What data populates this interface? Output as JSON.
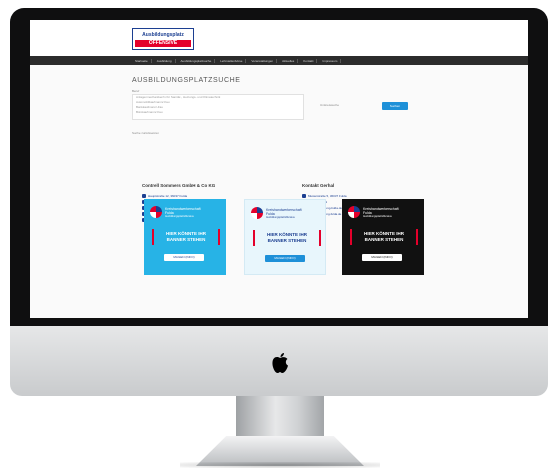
{
  "header": {
    "logo_line1": "Ausbildungsplatz",
    "logo_line2": "OFFENSIVE",
    "nav": [
      "Startseite",
      "Ausbildung",
      "Ausbildungsplatzsuche",
      "Lehrstellenbörse",
      "Veranstaltungen",
      "Aktuelles",
      "Kontakt",
      "Impressum"
    ]
  },
  "search": {
    "title": "AUSBILDUNGSPLATZSUCHE",
    "filter_label": "Beruf",
    "options": [
      "Anlagenmechaniker/in für Sanitär-, Heizungs- und Klimatechnik",
      "Automobilkaufmann/-frau",
      "Bankkaufmann/-frau",
      "Bürokaufmann/-frau"
    ],
    "distance_label": "Umkreissuche",
    "search_button": "Suchen",
    "reset_link": "Suche zurücksetzen"
  },
  "employer": {
    "name": "Contrell Sommers GmbH & Co KG",
    "rows": [
      "Hauptstraße 12, 36037 Fulda",
      "Ansprechpartner: Herr Sommers",
      "0661 / 123456",
      "bewerbung@contrell.de",
      "www.contrell.de"
    ]
  },
  "contact": {
    "name": "Kontakt Gerhal",
    "rows": [
      "Musterstraße 5, 36037 Fulda",
      "0661 / 654321",
      "info@ausbildung-fulda.de",
      "www.ausbildung-fulda.de"
    ]
  },
  "banners": [
    {
      "title": "Kreishandwerkerschaft",
      "title2": "Fulda",
      "sub": "Ausbildungsplatzoffensive",
      "text1": "HIER KÖNNTE IHR",
      "text2": "BANNER STEHEN",
      "button": "MAILEN (INFO)"
    },
    {
      "title": "Kreishandwerkerschaft",
      "title2": "Fulda",
      "sub": "Ausbildungsplatzoffensive",
      "text1": "HIER KÖNNTE IHR",
      "text2": "BANNER STEHEN",
      "button": "MAILEN (INFO)"
    },
    {
      "title": "Kreishandwerkerschaft",
      "title2": "Fulda",
      "sub": "Ausbildungsplatzoffensive",
      "text1": "HIER KÖNNTE IHR",
      "text2": "BANNER STEHEN",
      "button": "MAILEN (INFO)"
    }
  ],
  "colors": {
    "brand_blue": "#1c3f91",
    "brand_red": "#e4002b",
    "accent": "#1e90d8"
  }
}
